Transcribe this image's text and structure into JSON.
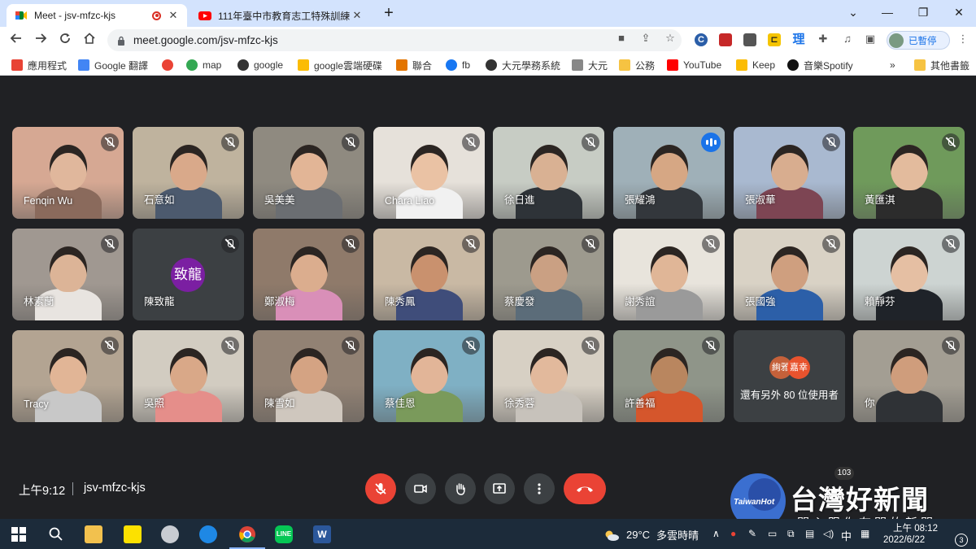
{
  "tabs": [
    {
      "title": "Meet - jsv-mfzc-kjs",
      "recording": true,
      "close": "✕"
    },
    {
      "title": "111年臺中市教育志工特殊訓練",
      "close": "✕"
    }
  ],
  "new_tab": "+",
  "window_controls": {
    "minimize": "—",
    "restore": "❐",
    "close": "✕",
    "tab_search": "⌄"
  },
  "toolbar": {
    "url": "meet.google.com/jsv-mfzc-kjs",
    "profile_label": "已暫停",
    "extension_label_1": "⊏",
    "extension_label_2": "理"
  },
  "bookmarks": [
    {
      "label": "應用程式",
      "icon": "apps-grid-icon",
      "color": "#e84335"
    },
    {
      "label": "Google 翻譯",
      "icon": "translate-icon",
      "color": "#4285f4"
    },
    {
      "label": "",
      "icon": "gmail-icon",
      "color": "#ea4335"
    },
    {
      "label": "map",
      "icon": "maps-pin-icon",
      "color": "#34a853"
    },
    {
      "label": "google",
      "icon": "globe-icon",
      "color": "#333333"
    },
    {
      "label": "google雲端硬碟",
      "icon": "drive-icon",
      "color": "#fbbc04"
    },
    {
      "label": "聯合",
      "icon": "udn-icon",
      "color": "#e37400"
    },
    {
      "label": "fb",
      "icon": "facebook-icon",
      "color": "#1877f2"
    },
    {
      "label": "大元學務系統",
      "icon": "globe-icon",
      "color": "#333333"
    },
    {
      "label": "大元",
      "icon": "page-icon",
      "color": "#888888"
    },
    {
      "label": "公務",
      "icon": "folder-icon",
      "color": "#f6c342"
    },
    {
      "label": "YouTube",
      "icon": "youtube-icon",
      "color": "#ff0000"
    },
    {
      "label": "Keep",
      "icon": "keep-icon",
      "color": "#fbbc04"
    },
    {
      "label": "音樂Spotify",
      "icon": "spotify-icon",
      "color": "#111111"
    }
  ],
  "bookmarks_overflow": "»",
  "other_bookmarks": "其他書籤",
  "participants": [
    {
      "name": "Fenqin Wu",
      "muted": true,
      "bg": "#d6a893",
      "skin": "#e0b79c",
      "shirt": "#8a6a5c"
    },
    {
      "name": "石意如",
      "muted": true,
      "bg": "#bfb39e",
      "skin": "#d9a98a",
      "shirt": "#4c5a6e"
    },
    {
      "name": "吳美美",
      "muted": true,
      "bg": "#8f8a80",
      "skin": "#e2b596",
      "shirt": "#6b6e72"
    },
    {
      "name": "Chara Liao",
      "muted": true,
      "bg": "#e6e1da",
      "skin": "#eac2a4",
      "shirt": "#f1f1f1"
    },
    {
      "name": "徐日進",
      "muted": true,
      "bg": "#c7ccc4",
      "skin": "#d9b193",
      "shirt": "#2e3338"
    },
    {
      "name": "張耀鴻",
      "muted": false,
      "speaking": true,
      "bg": "#9fb0b8",
      "skin": "#d6a784",
      "shirt": "#33373c"
    },
    {
      "name": "張淑華",
      "muted": true,
      "bg": "#a9b9d0",
      "skin": "#d8ad8f",
      "shirt": "#7d4553"
    },
    {
      "name": "黃匯淇",
      "muted": true,
      "bg": "#6f9a5b",
      "skin": "#e3bb9d",
      "shirt": "#2c2c2c"
    },
    {
      "name": "林素蘭",
      "muted": true,
      "bg": "#a09891",
      "skin": "#dcb497",
      "shirt": "#e8e4e0"
    },
    {
      "name": "陳致龍",
      "muted": true,
      "avatar": "致龍",
      "avatar_color": "#7b1fa2"
    },
    {
      "name": "鄭淑梅",
      "muted": true,
      "bg": "#8f7a6a",
      "skin": "#dbad8e",
      "shirt": "#d98fb8"
    },
    {
      "name": "陳秀鳳",
      "muted": true,
      "bg": "#c9b9a4",
      "skin": "#c9916e",
      "shirt": "#3f4d7a"
    },
    {
      "name": "蔡慶發",
      "muted": true,
      "bg": "#9d9a8e",
      "skin": "#caa083",
      "shirt": "#5b6c79"
    },
    {
      "name": "謝秀誼",
      "muted": true,
      "bg": "#e8e4dc",
      "skin": "#e0b697",
      "shirt": "#9a9a9a"
    },
    {
      "name": "張國強",
      "muted": true,
      "bg": "#d9d2c5",
      "skin": "#cf9f7f",
      "shirt": "#2c5fa8"
    },
    {
      "name": "賴靜芬",
      "muted": true,
      "bg": "#cdd4d2",
      "skin": "#e5bfa3",
      "shirt": "#1f2329"
    },
    {
      "name": "Tracy",
      "muted": true,
      "bg": "#b3a492",
      "skin": "#e1b596",
      "shirt": "#c8c8c8"
    },
    {
      "name": "吳照",
      "muted": true,
      "bg": "#d2ccc1",
      "skin": "#d9a888",
      "shirt": "#e58e8a"
    },
    {
      "name": "陳雪如",
      "muted": true,
      "bg": "#928274",
      "skin": "#d4a383",
      "shirt": "#cfc7be"
    },
    {
      "name": "蔡佳恩",
      "muted": true,
      "bg": "#7fb0c4",
      "skin": "#e2b598",
      "shirt": "#7a9a5b"
    },
    {
      "name": "徐秀蓉",
      "muted": true,
      "bg": "#d7d0c4",
      "skin": "#e2b99c",
      "shirt": "#c7c2bb"
    },
    {
      "name": "許善福",
      "muted": true,
      "bg": "#8f9589",
      "skin": "#b9865f",
      "shirt": "#d5562c"
    },
    {
      "name": "還有另外 80 位使用者",
      "more": true,
      "mini": [
        {
          "text": "絢雅",
          "color": "#c5613a"
        },
        {
          "text": "嘉幸",
          "color": "#e8532e"
        }
      ]
    },
    {
      "name": "你",
      "muted": true,
      "bg": "#a39e93",
      "skin": "#cf9d7c",
      "shirt": "#2f3236"
    }
  ],
  "meeting": {
    "time": "上午9:12",
    "code": "jsv-mfzc-kjs"
  },
  "watermark": {
    "brand": "TaiwanHot",
    "title": "台灣好新聞",
    "subtitle": "關心跟你有關的新聞",
    "badge": "103"
  },
  "taskbar": {
    "temperature": "29°C",
    "weather": "多雲時晴",
    "ime": "中",
    "clock": "上午 08:12",
    "date": "2022/6/22",
    "notifications": "3"
  },
  "colors": {
    "meet_bg": "#202124",
    "tile_bg": "#3c4043",
    "accent": "#1a73e8",
    "danger": "#ea4335"
  }
}
